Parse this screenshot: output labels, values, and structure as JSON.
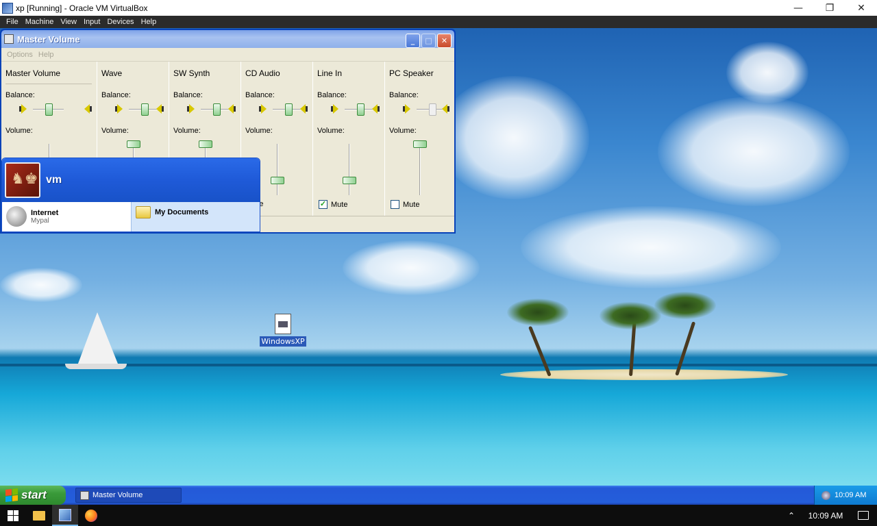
{
  "host": {
    "title": "xp [Running] - Oracle VM VirtualBox",
    "controls": {
      "minimize": "—",
      "restore": "❐",
      "close": "✕"
    },
    "menu": [
      "File",
      "Machine",
      "View",
      "Input",
      "Devices",
      "Help"
    ],
    "taskbar": {
      "time": "10:09 AM",
      "tray_chevron": "⌃"
    }
  },
  "volume_window": {
    "title": "Master Volume",
    "menu": [
      "Options",
      "Help"
    ],
    "buttons": {
      "minimize": "_",
      "maximize": "□",
      "close": "✕"
    },
    "balance_label": "Balance:",
    "volume_label": "Volume:",
    "channels": [
      {
        "name": "Master Volume",
        "balance": 0.5,
        "volume": null,
        "mute_label": "",
        "muted": null
      },
      {
        "name": "Wave",
        "balance": 0.5,
        "volume": 1.0,
        "mute_label": "",
        "muted": null
      },
      {
        "name": "SW Synth",
        "balance": 0.5,
        "volume": 1.0,
        "mute_label": "",
        "muted": null
      },
      {
        "name": "CD Audio",
        "balance": 0.5,
        "volume": 0.3,
        "mute_label": "Mute",
        "muted": null
      },
      {
        "name": "Line In",
        "balance": 0.5,
        "volume": 0.3,
        "mute_label": "Mute",
        "muted": true
      },
      {
        "name": "PC Speaker",
        "balance": 0.5,
        "volume": 1.0,
        "mute_label": "Mute",
        "muted": false
      }
    ]
  },
  "start_menu": {
    "username": "vm",
    "pinned": {
      "title": "Internet",
      "subtitle": "Mypal"
    },
    "right_item": "My Documents"
  },
  "desktop": {
    "icon_label": "WindowsXP"
  },
  "xp_taskbar": {
    "start_label": "start",
    "task_label": "Master Volume",
    "time": "10:09 AM"
  },
  "colors": {
    "xp_blue": "#245edb",
    "start_green": "#3a9a3a",
    "xp_face": "#ece9d8"
  }
}
